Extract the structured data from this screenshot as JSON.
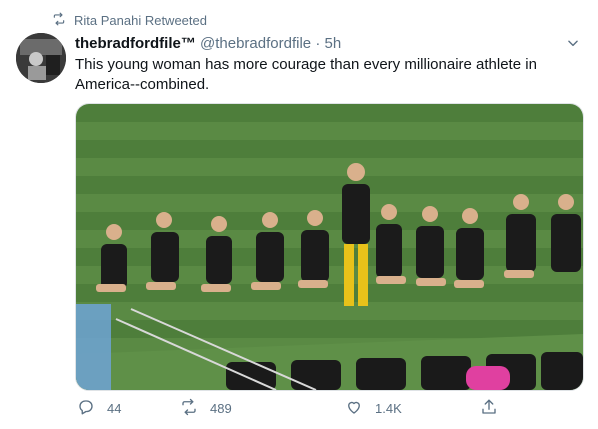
{
  "retweet_context": {
    "text": "Rita Panahi Retweeted",
    "icon": "retweet-icon"
  },
  "tweet": {
    "display_name": "thebradfordfile™",
    "handle": "@thebradfordfile",
    "separator": "·",
    "time": "5h",
    "text": "This young woman has more courage than every millionaire athlete in America--combined."
  },
  "actions": {
    "reply_count": "44",
    "retweet_count": "489",
    "like_count": "1.4K"
  },
  "colors": {
    "secondary_text": "#5b7083",
    "primary_text": "#0f1419"
  }
}
